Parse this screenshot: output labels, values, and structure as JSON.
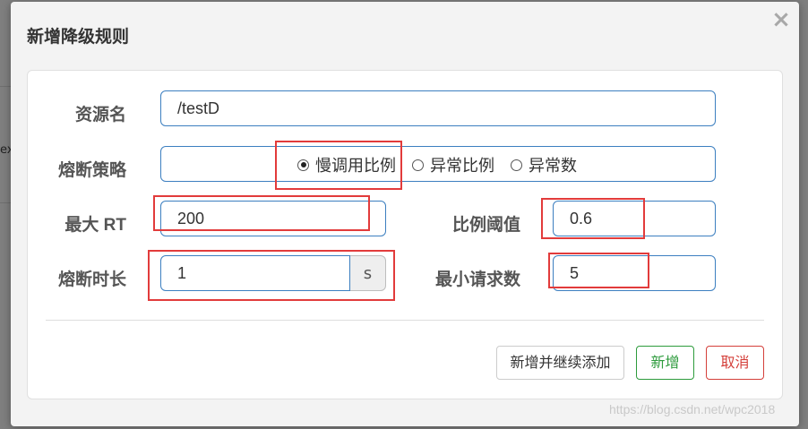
{
  "background": {
    "partial_text": "ex"
  },
  "modal": {
    "title": "新增降级规则",
    "close_glyph": "×",
    "form": {
      "resource_label": "资源名",
      "resource_value": "/testD",
      "strategy_label": "熔断策略",
      "strategies": [
        {
          "label": "慢调用比例",
          "checked": true
        },
        {
          "label": "异常比例",
          "checked": false
        },
        {
          "label": "异常数",
          "checked": false
        }
      ],
      "max_rt_label": "最大 RT",
      "max_rt_value": "200",
      "ratio_threshold_label": "比例阈值",
      "ratio_threshold_value": "0.6",
      "break_duration_label": "熔断时长",
      "break_duration_value": "1",
      "break_duration_unit": "s",
      "min_request_label": "最小请求数",
      "min_request_value": "5"
    },
    "footer": {
      "add_continue_label": "新增并继续添加",
      "add_label": "新增",
      "cancel_label": "取消"
    }
  },
  "watermark": "https://blog.csdn.net/wpc2018",
  "colors": {
    "primary_border": "#3c7fc0",
    "annotation_red": "#e23b3b",
    "success_green": "#2d9b3c",
    "danger_red": "#d43f3a"
  }
}
